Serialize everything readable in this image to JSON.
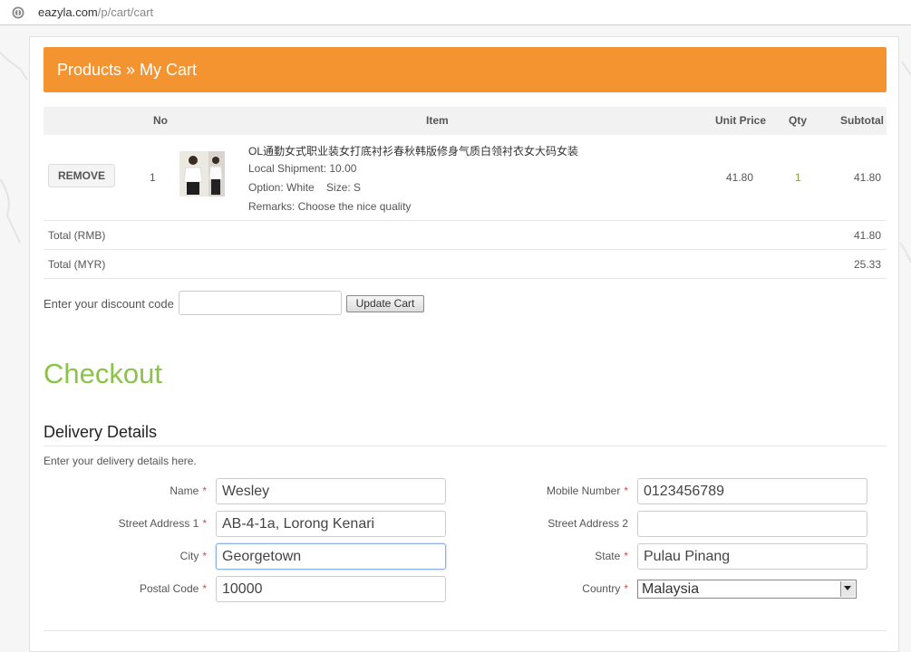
{
  "browser": {
    "url_host": "eazyla.com",
    "url_path": "/p/cart/cart"
  },
  "banner": {
    "title": "Products » My Cart"
  },
  "cart": {
    "columns": {
      "no": "No",
      "item": "Item",
      "unit_price": "Unit Price",
      "qty": "Qty",
      "subtotal": "Subtotal"
    },
    "items": [
      {
        "remove_label": "REMOVE",
        "no": "1",
        "name": "OL通勤女式职业装女打底衬衫春秋韩版修身气质白领衬衣女大码女装",
        "shipment": "Local Shipment: 10.00",
        "option": "Option: White    Size: S",
        "remarks": "Remarks: Choose the nice quality",
        "unit_price": "41.80",
        "qty": "1",
        "subtotal": "41.80"
      }
    ],
    "totals": [
      {
        "label": "Total (RMB)",
        "value": "41.80"
      },
      {
        "label": "Total (MYR)",
        "value": "25.33"
      }
    ],
    "discount_label": "Enter your discount code",
    "discount_value": "",
    "update_label": "Update Cart"
  },
  "checkout": {
    "title": "Checkout",
    "delivery_title": "Delivery Details",
    "delivery_desc": "Enter your delivery details here.",
    "required_mark": "*",
    "fields": {
      "name": {
        "label": "Name",
        "value": "Wesley"
      },
      "street1": {
        "label": "Street Address 1",
        "value": "AB-4-1a, Lorong Kenari"
      },
      "city": {
        "label": "City",
        "value": "Georgetown"
      },
      "postal": {
        "label": "Postal Code",
        "value": "10000"
      },
      "mobile": {
        "label": "Mobile Number",
        "value": "0123456789"
      },
      "street2": {
        "label": "Street Address 2",
        "value": ""
      },
      "state": {
        "label": "State",
        "value": "Pulau Pinang"
      },
      "country": {
        "label": "Country",
        "value": "Malaysia"
      }
    }
  },
  "colors": {
    "banner": "#f39431",
    "checkout_title": "#8bc34a",
    "required": "#e0434b"
  }
}
